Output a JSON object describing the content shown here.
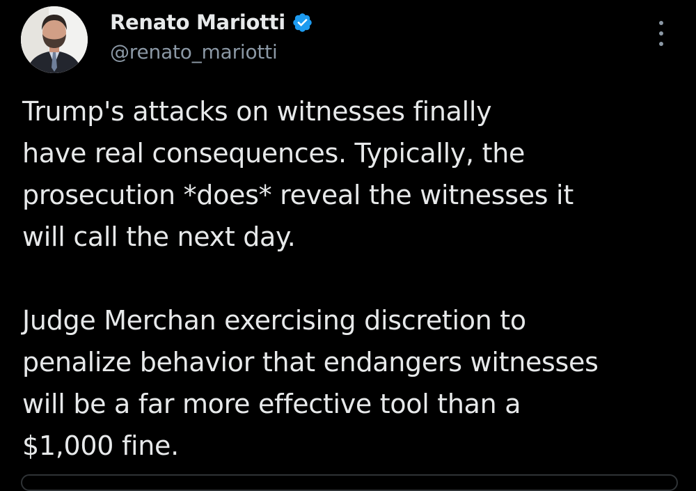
{
  "author": {
    "display_name": "Renato Mariotti",
    "handle": "@renato_mariotti",
    "verified": true
  },
  "tweet": {
    "paragraph_1": [
      "Trump's attacks on witnesses finally",
      "have real consequences. Typically, the",
      "prosecution *does* reveal the witnesses it",
      "will call the next day."
    ],
    "paragraph_2": [
      "Judge Merchan exercising discretion to",
      "penalize behavior that endangers witnesses",
      "will be a far more effective tool than a",
      "$1,000 fine."
    ]
  },
  "icons": {
    "verified": "verified-badge-icon",
    "more": "more-options-icon"
  },
  "colors": {
    "background": "#000000",
    "primary_text": "#e7e9ea",
    "secondary_text": "#8b98a5",
    "verified_blue": "#1d9bf0"
  }
}
